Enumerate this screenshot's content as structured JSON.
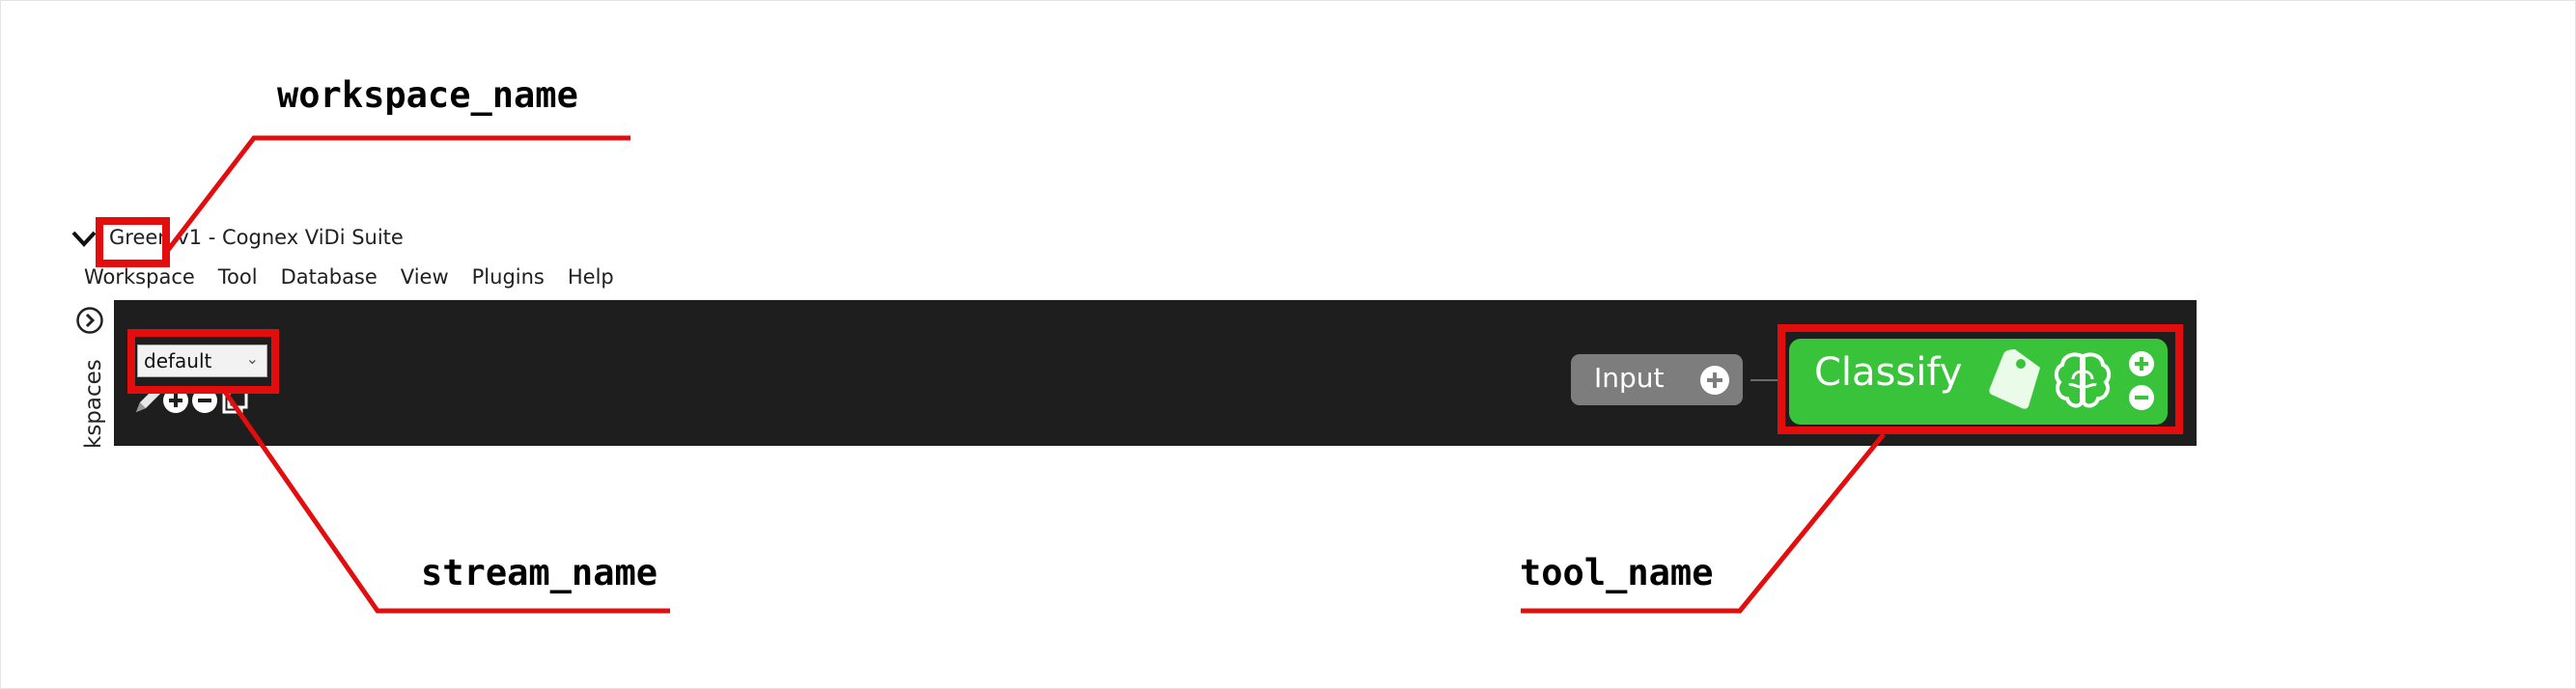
{
  "window": {
    "title": "Green v1 - Cognex ViDi Suite"
  },
  "menu": {
    "items": [
      "Workspace",
      "Tool",
      "Database",
      "View",
      "Plugins",
      "Help"
    ]
  },
  "sidebar": {
    "label": "Workspaces",
    "visible_label": "kspaces"
  },
  "stream": {
    "selected": "default"
  },
  "nodes": {
    "input_label": "Input",
    "tool_label": "Classify"
  },
  "annotations": {
    "workspace_name": "workspace_name",
    "stream_name": "stream_name",
    "tool_name": "tool_name"
  },
  "colors": {
    "panel_bg": "#1e1e1e",
    "classify_green": "#38c33a",
    "input_gray": "#7d7d7d",
    "annotation_red": "#e30d0d"
  },
  "icons": {
    "chevron": "chevron-down-icon",
    "side_toggle": "chevron-right-circle-icon",
    "tag": "tag-icon",
    "brain": "brain-icon",
    "plus": "plus-circle-icon",
    "minus": "minus-circle-icon"
  }
}
